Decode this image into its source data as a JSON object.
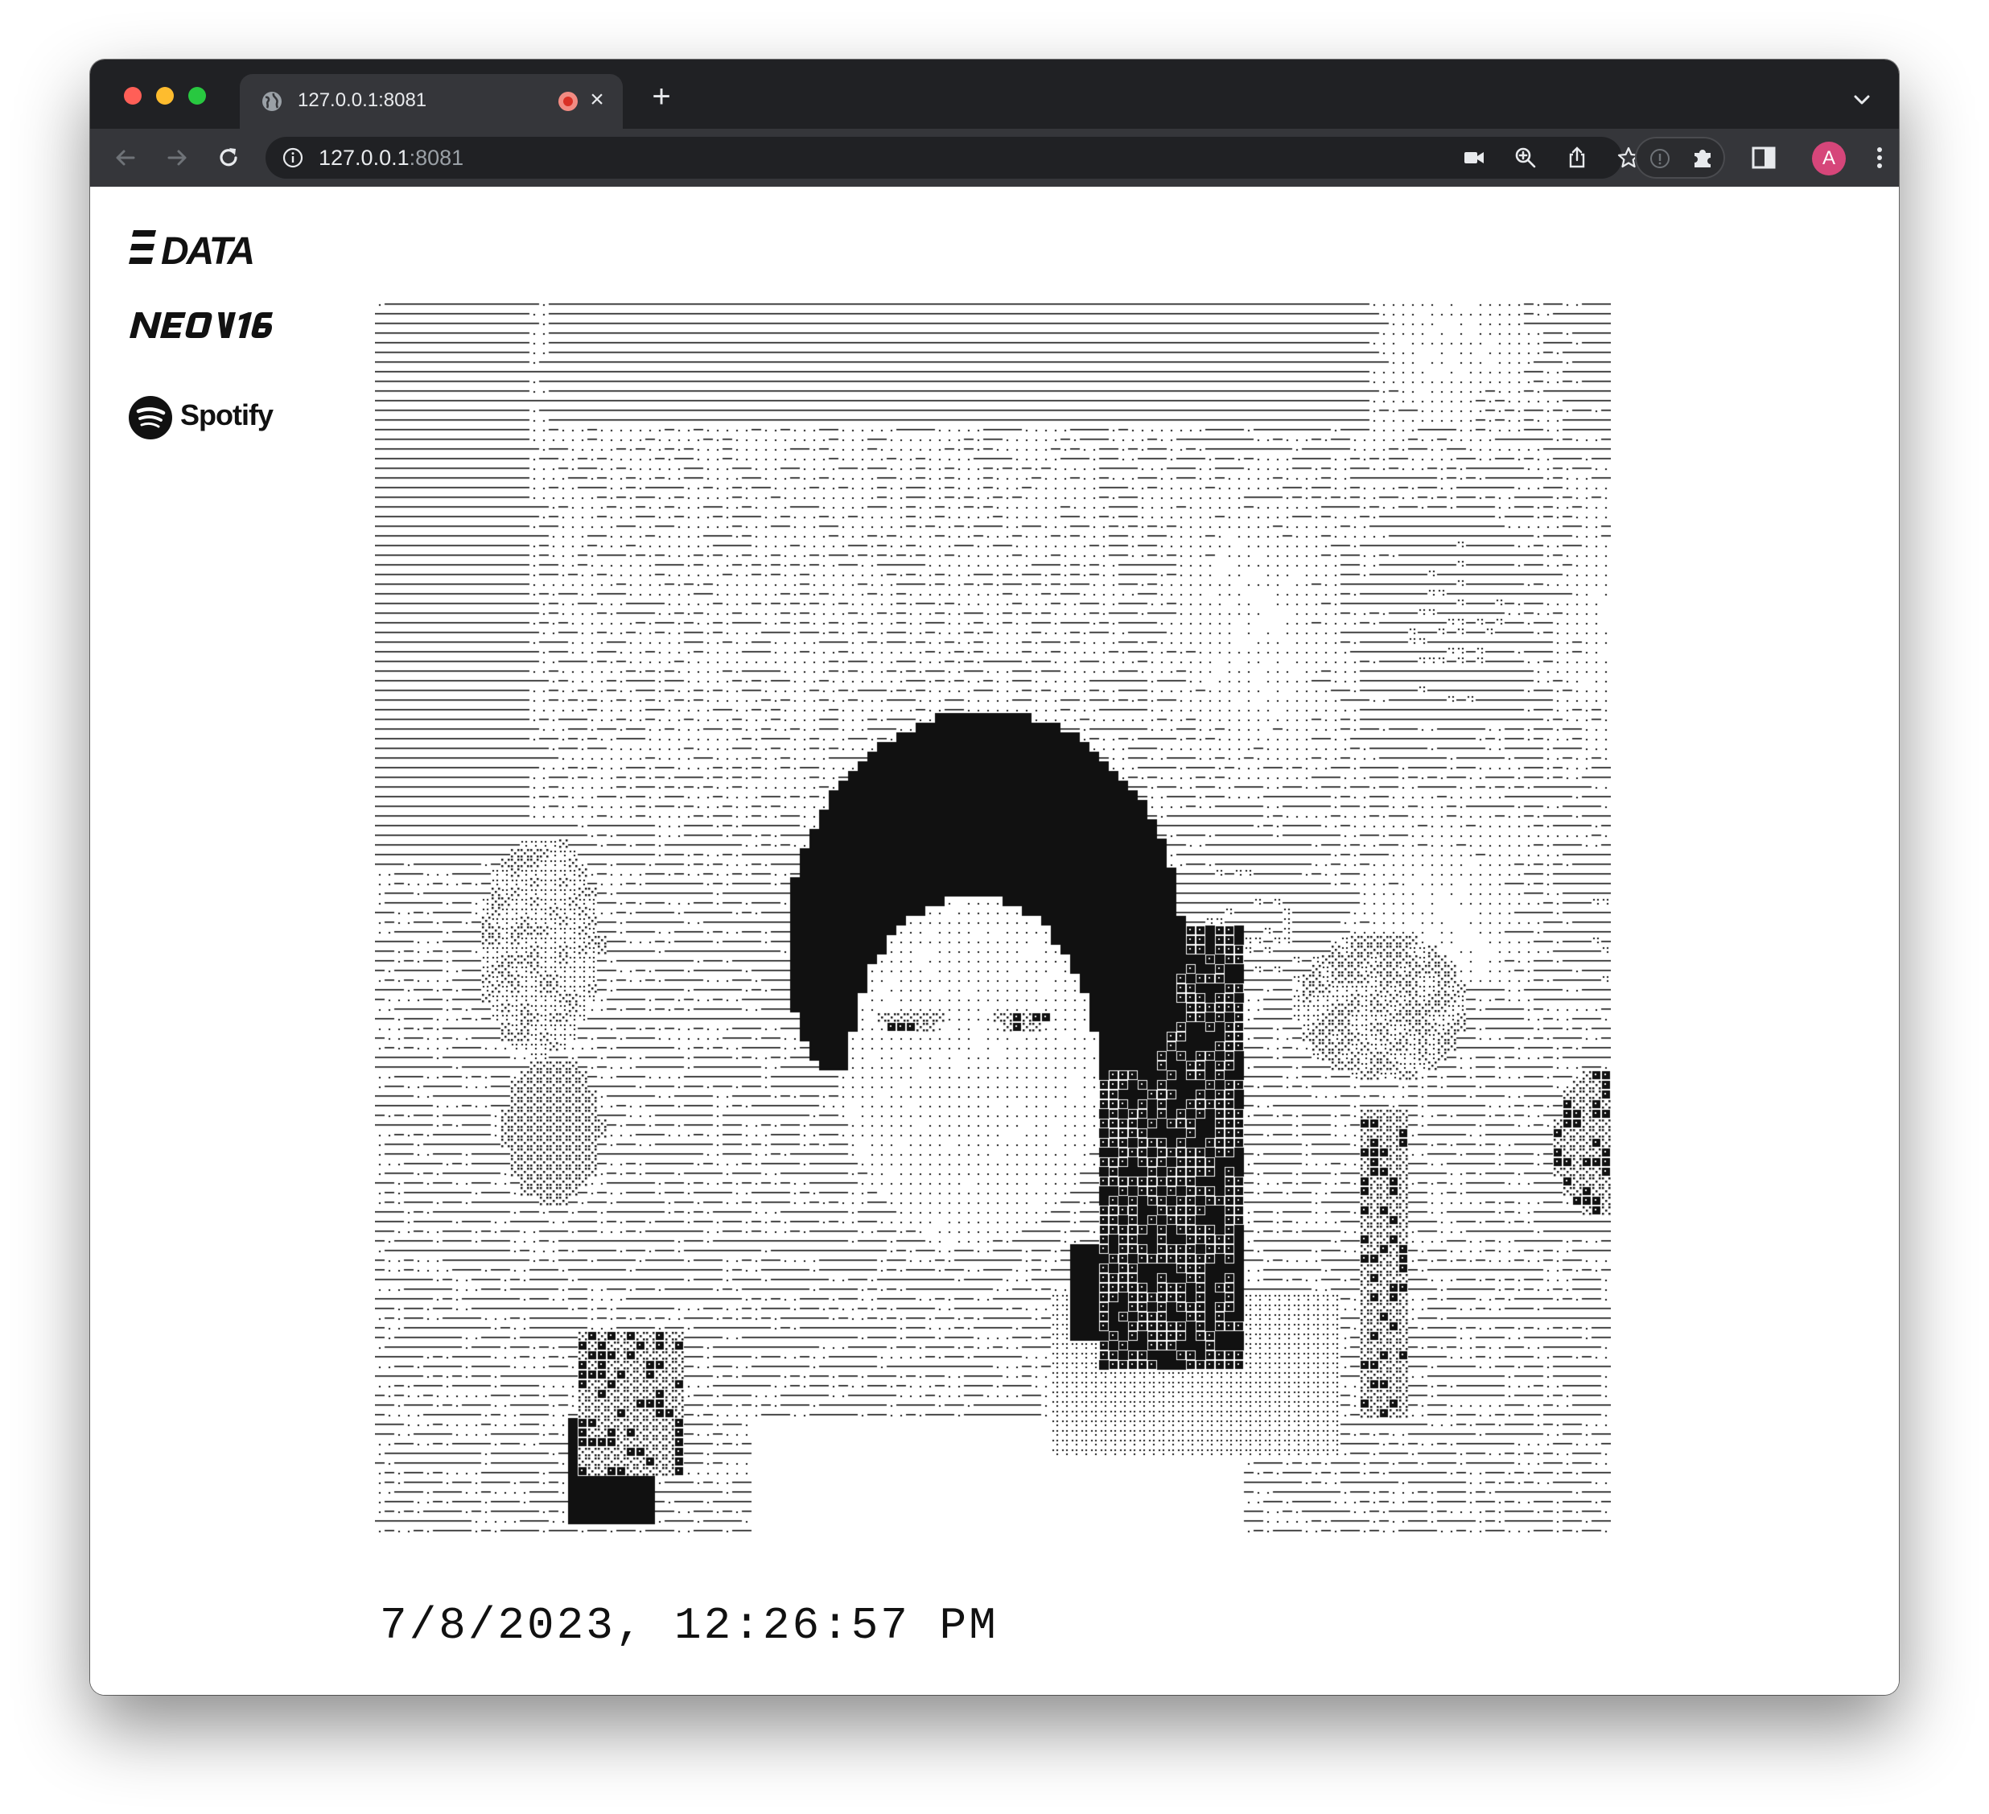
{
  "browser": {
    "tab_title": "127.0.0.1:8081",
    "url_host": "127.0.0.1",
    "url_port": ":8081",
    "avatar_letter": "A",
    "tab_close_glyph": "×",
    "new_tab_glyph": "+"
  },
  "page": {
    "logos": {
      "data_logo_text": "DATA",
      "neon_logo_text": "NEON16",
      "spotify_text": "Spotify"
    },
    "ascii_image": {
      "description_icon": "ascii-art-portrait",
      "background": "#ffffff",
      "ink": "#111111"
    },
    "timestamp": "7/8/2023, 12:26:57 PM"
  }
}
